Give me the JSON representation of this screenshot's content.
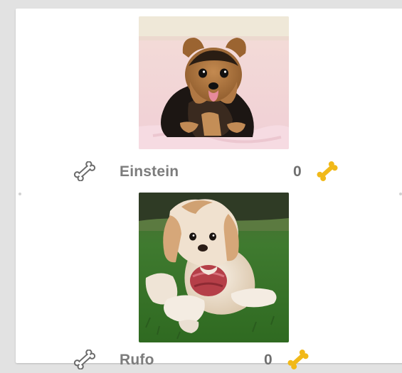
{
  "colors": {
    "background": "#e2e2e2",
    "card": "#ffffff",
    "name_text": "#7c7c7c",
    "count_text": "#6f6f6f",
    "bone_gold": "#f1b919",
    "bone_outline": "#6b6b6b"
  },
  "pets": [
    {
      "name": "Einstein",
      "count": "0",
      "photo_icon": "yorkie-puppy-photo",
      "give_bone_icon": "bone-outline-icon",
      "received_bone_icon": "bone-gold-icon"
    },
    {
      "name": "Rufo",
      "count": "0",
      "photo_icon": "cockapoo-puppy-photo",
      "give_bone_icon": "bone-outline-icon",
      "received_bone_icon": "bone-gold-icon"
    }
  ]
}
